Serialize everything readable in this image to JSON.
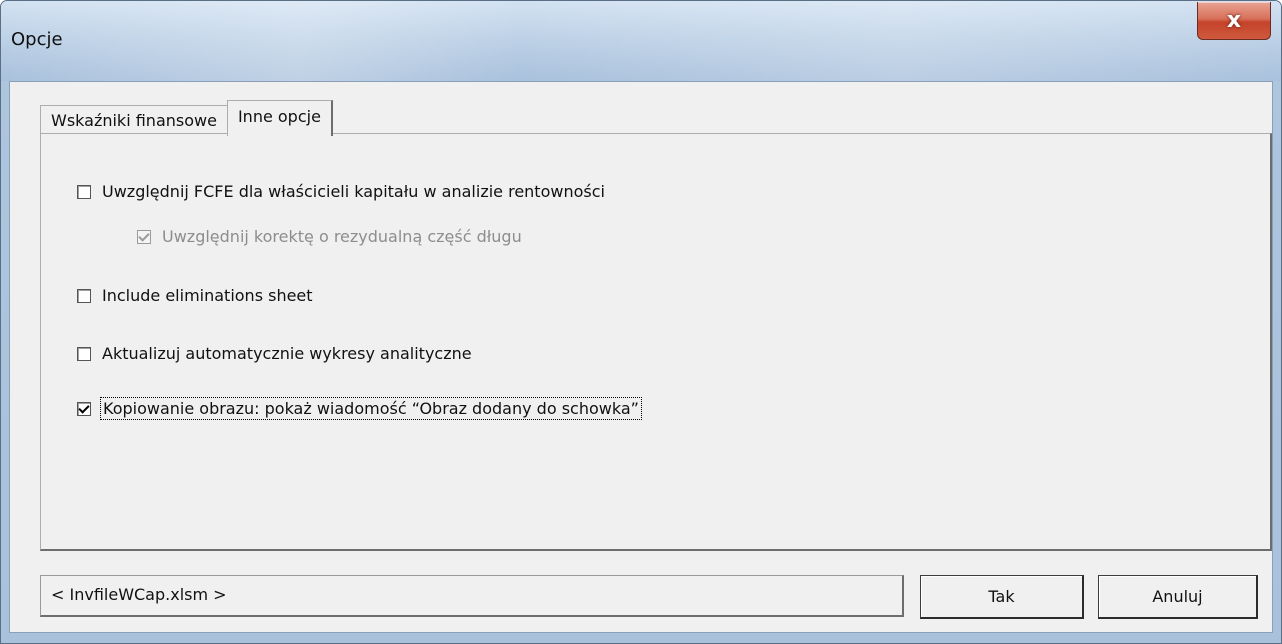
{
  "window": {
    "title": "Opcje",
    "close_label": "x"
  },
  "tabs": [
    {
      "label": "Wskaźniki finansowe",
      "active": false
    },
    {
      "label": "Inne opcje",
      "active": true
    }
  ],
  "options": [
    {
      "label": "Uwzględnij FCFE dla właścicieli kapitału w analizie rentowności",
      "checked": false,
      "enabled": true
    },
    {
      "label": "Uwzględnij korektę o rezydualną część długu",
      "checked": true,
      "enabled": false
    },
    {
      "label": "Include eliminations sheet",
      "checked": false,
      "enabled": true
    },
    {
      "label": "Aktualizuj automatycznie wykresy analityczne",
      "checked": false,
      "enabled": true
    },
    {
      "label": "Kopiowanie obrazu: pokaż wiadomość “Obraz dodany do schowka”",
      "checked": true,
      "enabled": true,
      "focused": true
    }
  ],
  "status": {
    "file": "< InvfileWCap.xlsm >"
  },
  "buttons": {
    "ok": "Tak",
    "cancel_prefix": "Anulu",
    "cancel_underlined": "j"
  }
}
